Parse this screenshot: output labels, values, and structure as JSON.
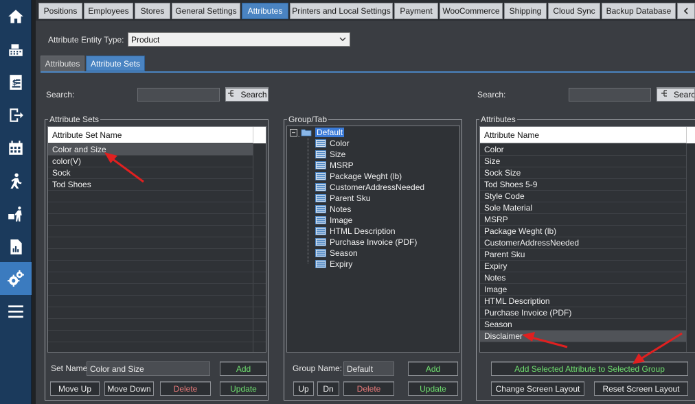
{
  "tabs": [
    "Positions",
    "Employees",
    "Stores",
    "General Settings",
    "Attributes",
    "Printers and Local Settings",
    "Payment",
    "WooCommerce",
    "Shipping",
    "Cloud Sync",
    "Backup Database"
  ],
  "tab_scroll_icon": "chevron-left-icon",
  "nav_icons": [
    "home-icon",
    "cash-register-icon",
    "invoice-icon",
    "exit-icon",
    "calendar-icon",
    "walking-person-icon",
    "delivery-icon",
    "report-icon",
    "settings-gears-icon",
    "hamburger-menu-icon"
  ],
  "accent_color": "#4a84c2",
  "entity": {
    "label": "Attribute Entity Type:",
    "value": "Product"
  },
  "subtabs": [
    "Attributes",
    "Attribute Sets"
  ],
  "left_search": {
    "label": "Search:",
    "value": "",
    "button": "Search"
  },
  "right_search": {
    "label": "Search:",
    "value": "",
    "button": "Search"
  },
  "attribute_sets": {
    "title": "Attribute Sets",
    "header": "Attribute Set Name",
    "rows": [
      "Color and Size",
      "color(V)",
      "Sock",
      "Tod Shoes"
    ],
    "selected_index": 0,
    "set_name_label": "Set Name:",
    "set_name_value": "Color and Size",
    "add": "Add",
    "move_up": "Move Up",
    "move_down": "Move Down",
    "delete": "Delete",
    "update": "Update"
  },
  "group_tab": {
    "title": "Group/Tab",
    "root": "Default",
    "children": [
      "Color",
      "Size",
      "MSRP",
      "Package Weght (lb)",
      "CustomerAddressNeeded",
      "Parent Sku",
      "Notes",
      "Image",
      "HTML Description",
      "Purchase Invoice (PDF)",
      "Season",
      "Expiry"
    ],
    "group_name_label": "Group Name:",
    "group_name_value": "Default",
    "add": "Add",
    "up": "Up",
    "dn": "Dn",
    "delete": "Delete",
    "update": "Update"
  },
  "attributes": {
    "title": "Attributes",
    "header": "Attribute Name",
    "rows": [
      "Color",
      "Size",
      "Sock Size",
      "Tod Shoes 5-9",
      "Style Code",
      "Sole Material",
      "MSRP",
      "Package Weght (lb)",
      "CustomerAddressNeeded",
      "Parent Sku",
      "Expiry",
      "Notes",
      "Image",
      "HTML Description",
      "Purchase Invoice (PDF)",
      "Season",
      "Disclaimer"
    ],
    "selected_index": 16,
    "add_selected": "Add Selected Attribute to Selected Group",
    "change_layout": "Change Screen Layout",
    "reset_layout": "Reset Screen Layout"
  }
}
